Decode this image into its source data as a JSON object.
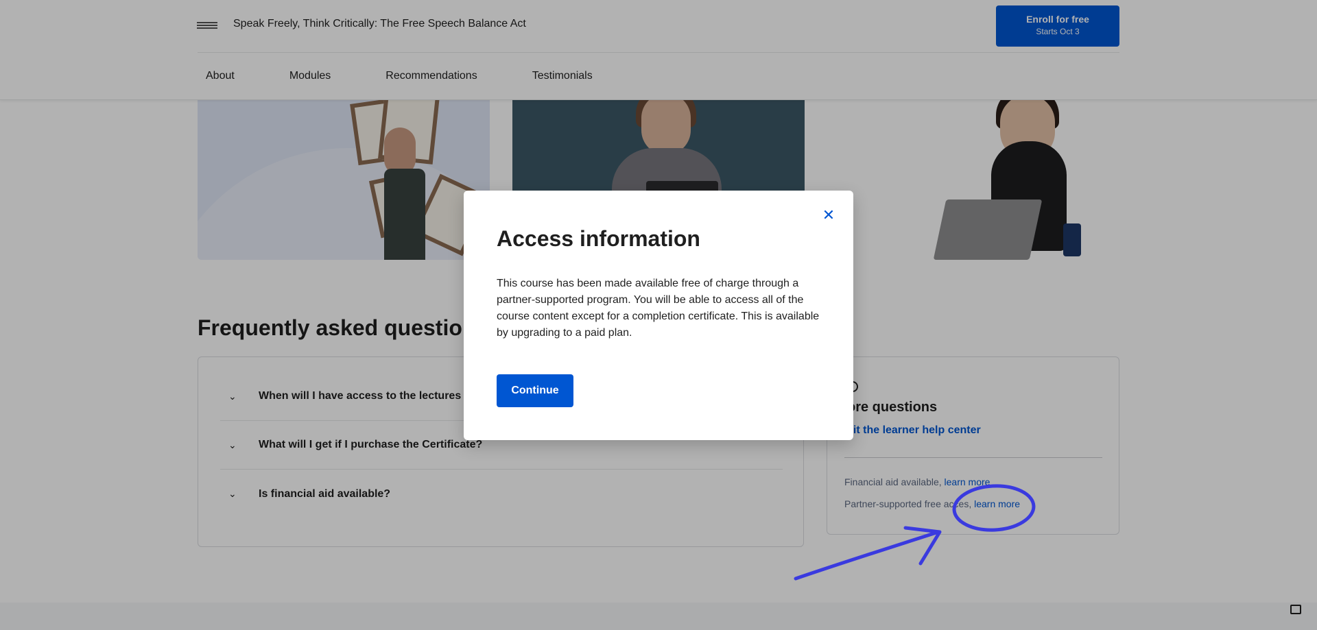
{
  "header": {
    "course_title": "Speak Freely, Think Critically: The Free Speech Balance Act",
    "enroll_label": "Enroll for free",
    "enroll_sub": "Starts Oct 3",
    "nav": [
      "About",
      "Modules",
      "Recommendations",
      "Testimonials"
    ]
  },
  "faq": {
    "title": "Frequently asked questions",
    "items": [
      "When will I have access to the lectures and as",
      "What will I get if I purchase the Certificate?",
      "Is financial aid available?"
    ]
  },
  "side": {
    "heading": "ore questions",
    "help_link": "sit the learner help center",
    "financial_prefix": "Financial aid available,",
    "financial_link": "learn more",
    "partner_prefix": "Partner-supported free acce",
    "partner_mid": "s,",
    "partner_link": "learn more"
  },
  "modal": {
    "title": "Access information",
    "body": "This course has been made available free of charge through a partner-supported program. You will be able to access all of the course content except for a completion certificate. This is available by upgrading to a paid plan.",
    "continue_label": "Continue",
    "close_icon": "close-icon"
  },
  "annotation": {
    "color": "#3a3adf"
  },
  "colors": {
    "primary": "#0056d2"
  }
}
